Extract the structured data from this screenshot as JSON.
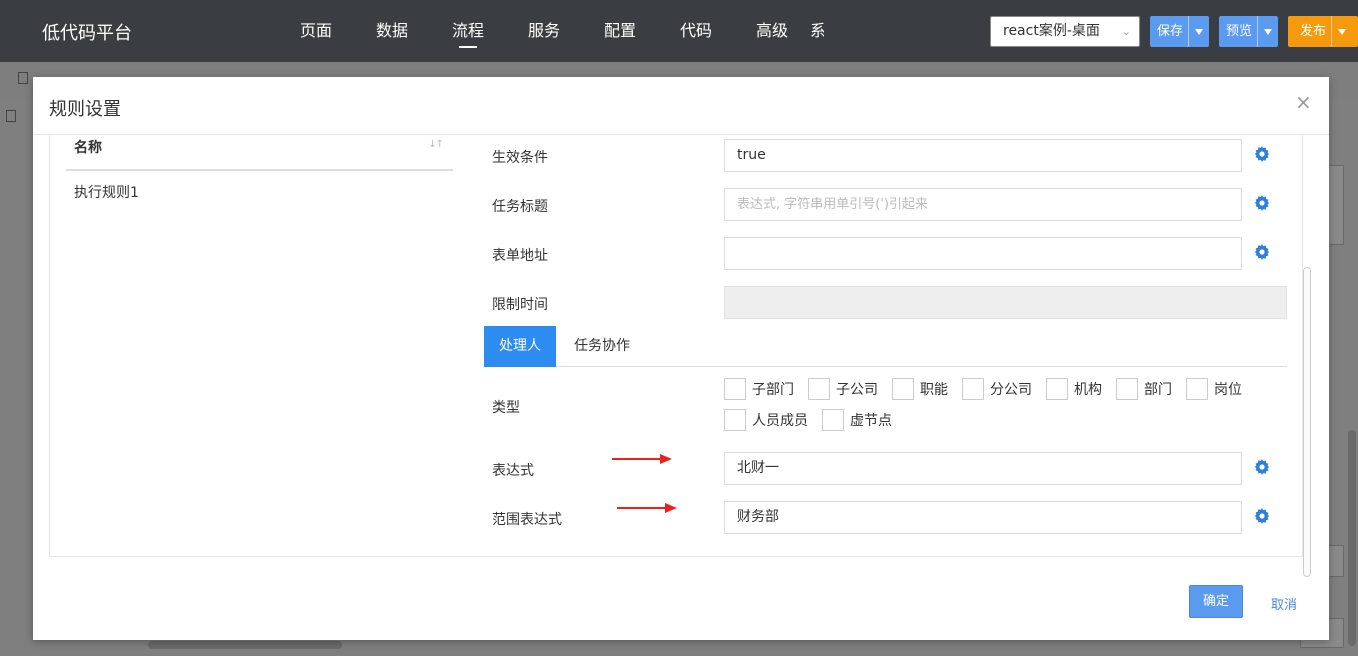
{
  "topbar": {
    "brand": "低代码平台",
    "nav": [
      "页面",
      "数据",
      "流程",
      "服务",
      "配置",
      "代码",
      "高级"
    ],
    "nav_cut": "系",
    "active_nav": "流程",
    "project_select": "react案例-桌面",
    "save_label": "保存",
    "preview_label": "预览",
    "publish_label": "发布"
  },
  "modal": {
    "title": "规则设置",
    "list": {
      "header": "名称",
      "items": [
        "执行规则1"
      ]
    },
    "form": {
      "effective_condition": {
        "label": "生效条件",
        "value": "true"
      },
      "task_title": {
        "label": "任务标题",
        "placeholder": "表达式, 字符串用单引号(')引起来"
      },
      "form_url": {
        "label": "表单地址",
        "value": ""
      },
      "time_limit": {
        "label": "限制时间",
        "value": ""
      },
      "tabs": [
        "处理人",
        "任务协作"
      ],
      "type": {
        "label": "类型",
        "row1": [
          "子部门",
          "子公司",
          "职能",
          "分公司",
          "机构",
          "部门",
          "岗位"
        ],
        "row2": [
          "人员成员",
          "虚节点"
        ]
      },
      "expression": {
        "label": "表达式",
        "value": "北财一"
      },
      "range_expression": {
        "label": "范围表达式",
        "value": "财务部"
      }
    },
    "ok_label": "确定",
    "cancel_label": "取消"
  },
  "colors": {
    "topbar": "#3a3d42",
    "primary": "#5a9bf0",
    "tab_active": "#2d8cf0",
    "publish": "#f59a0c",
    "annotation_arrow": "#e8231b"
  }
}
